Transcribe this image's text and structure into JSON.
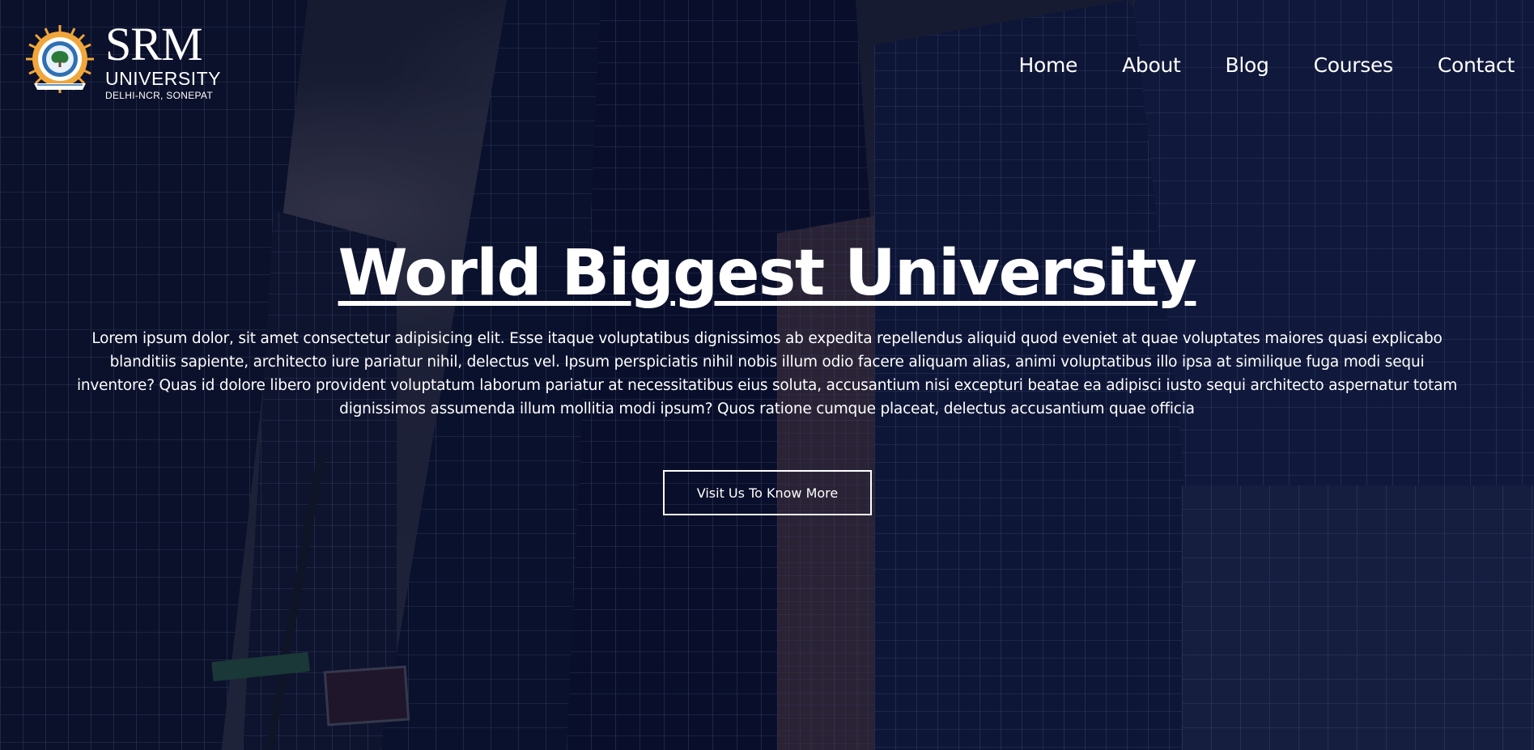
{
  "brand": {
    "name": "SRM",
    "subtitle": "UNIVERSITY",
    "location": "DELHI-NCR, SONEPAT",
    "accent": "#f0a63a"
  },
  "nav": {
    "items": [
      {
        "label": "Home"
      },
      {
        "label": "About"
      },
      {
        "label": "Blog"
      },
      {
        "label": "Courses"
      },
      {
        "label": "Contact"
      }
    ]
  },
  "hero": {
    "title": "World Biggest University",
    "body": "Lorem ipsum dolor, sit amet consectetur adipisicing elit. Esse itaque voluptatibus dignissimos ab expedita repellendus aliquid quod eveniet at quae voluptates maiores quasi explicabo blanditiis sapiente, architecto iure pariatur nihil, delectus vel. Ipsum perspiciatis nihil nobis illum odio facere aliquam alias, animi voluptatibus illo ipsa at similique fuga modi sequi inventore? Quas id dolore libero provident voluptatum laborum pariatur at necessitatibus eius soluta, accusantium nisi excepturi beatae ea adipisci iusto sequi architecto aspernatur totam dignissimos assumenda illum mollitia modi ipsum? Quos ratione cumque placeat, delectus accusantium quae officia",
    "cta_label": "Visit Us To Know More"
  },
  "colors": {
    "overlay": "#0a0e28",
    "text": "#ffffff"
  }
}
